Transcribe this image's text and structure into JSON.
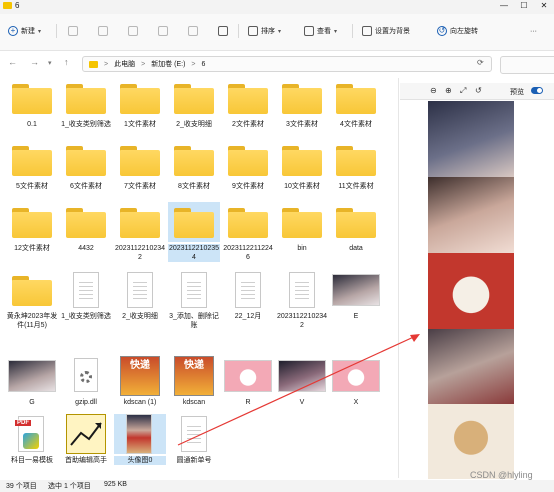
{
  "window": {
    "title": "6",
    "controls": [
      "—",
      "☐",
      "✕"
    ]
  },
  "toolbar": {
    "new_label": "新建",
    "sort_label": "排序",
    "view_label": "查看",
    "set_background_label": "设置为背景",
    "rotate_left_label": "向左旋转",
    "more_label": "···"
  },
  "address": {
    "crumbs": [
      "此电脑",
      "新加卷 (E:)",
      "6"
    ],
    "separator": ">"
  },
  "items": [
    {
      "label": "0.1",
      "kind": "folder"
    },
    {
      "label": "1_收支类别筛选",
      "kind": "folder"
    },
    {
      "label": "1文件素材",
      "kind": "folder"
    },
    {
      "label": "2_收支明细",
      "kind": "folder"
    },
    {
      "label": "2文件素材",
      "kind": "folder"
    },
    {
      "label": "3文件素材",
      "kind": "folder"
    },
    {
      "label": "4文件素材",
      "kind": "folder"
    },
    {
      "label": "5文件素材",
      "kind": "folder"
    },
    {
      "label": "6文件素材",
      "kind": "folder"
    },
    {
      "label": "7文件素材",
      "kind": "folder"
    },
    {
      "label": "8文件素材",
      "kind": "folder"
    },
    {
      "label": "9文件素材",
      "kind": "folder"
    },
    {
      "label": "10文件素材",
      "kind": "folder"
    },
    {
      "label": "11文件素材",
      "kind": "folder"
    },
    {
      "label": "12文件素材",
      "kind": "folder"
    },
    {
      "label": "4432",
      "kind": "folder"
    },
    {
      "label": "20231122102342",
      "kind": "folder"
    },
    {
      "label": "20231122102354",
      "kind": "folder",
      "selected": true
    },
    {
      "label": "20231122112246",
      "kind": "folder"
    },
    {
      "label": "bin",
      "kind": "folder"
    },
    {
      "label": "data",
      "kind": "folder"
    },
    {
      "label": "黄永坤2023年发件(11月5)",
      "kind": "folder"
    },
    {
      "label": "1_收支类别筛选",
      "kind": "doc"
    },
    {
      "label": "2_收支明细",
      "kind": "doc"
    },
    {
      "label": "3_添加、删除记账",
      "kind": "doc"
    },
    {
      "label": "22_12月",
      "kind": "doc"
    },
    {
      "label": "20231122102342",
      "kind": "doc"
    },
    {
      "label": "E",
      "kind": "photo"
    },
    {
      "label": "G",
      "kind": "photo"
    },
    {
      "label": "gzip.dll",
      "kind": "gear"
    },
    {
      "label": "kdscan (1)",
      "kind": "kd"
    },
    {
      "label": "kdscan",
      "kind": "kd"
    },
    {
      "label": "R",
      "kind": "photo-pink"
    },
    {
      "label": "V",
      "kind": "photo-dark"
    },
    {
      "label": "X",
      "kind": "photo-pink"
    },
    {
      "label": "科目一易模板",
      "kind": "pdf"
    },
    {
      "label": "首助编辑高手",
      "kind": "chart"
    },
    {
      "label": "头像图0",
      "kind": "photo-tall",
      "selected": true
    },
    {
      "label": "圆通新单号",
      "kind": "doc"
    }
  ],
  "kd_text": "快递",
  "pdf_badge": "PDF",
  "preview": {
    "toggle_label": "预览",
    "zoom_out": "⊖",
    "zoom_in": "⊕",
    "zoom_fit": "⤢",
    "rotate": "↺"
  },
  "statusbar": {
    "count": "39 个项目",
    "selected": "选中 1 个项目",
    "size": "925 KB"
  },
  "watermark": "CSDN @hlyling",
  "colors": {
    "accent": "#1a5fb4",
    "arrow": "#e53935",
    "folder": "#f8c737"
  }
}
